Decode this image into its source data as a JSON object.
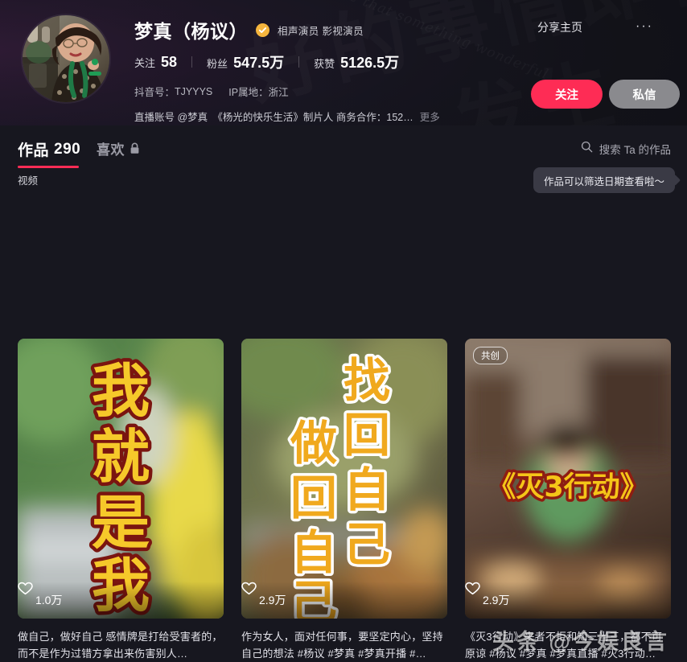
{
  "profile": {
    "name": "梦真（杨议）",
    "verified_icon": "verified-check-icon",
    "verified_tags": "相声演员 影视演员",
    "stats": [
      {
        "label": "关注",
        "value": "58"
      },
      {
        "label": "粉丝",
        "value": "547.5万"
      },
      {
        "label": "获赞",
        "value": "5126.5万"
      }
    ],
    "douyin_id_label": "抖音号：",
    "douyin_id_value": "TJYYYS",
    "ip_label": "IP属地：",
    "ip_value": "浙江",
    "bio": "直播账号 @梦真　《杨光的快乐生活》制片人 商务合作：152…",
    "bio_more": "更多",
    "share_label": "分享主页",
    "more_dots": "···",
    "follow_label": "关注",
    "message_label": "私信",
    "background_zh": "好的事情即将",
    "background_zh2": "发生",
    "background_en": "Always believe that something wonderful"
  },
  "tabs": {
    "works_label": "作品",
    "works_count": "290",
    "likes_label": "喜欢",
    "likes_lock_icon": "lock-icon",
    "search_icon": "search-icon",
    "search_placeholder": "搜索 Ta 的作品"
  },
  "filters": {
    "video_label": "视频",
    "tooltip": "作品可以筛选日期查看啦～"
  },
  "videos": [
    {
      "overlay_text": "我就是我",
      "overlay_style": "vertical-gold-red",
      "badge": "",
      "like_icon": "heart-icon",
      "likes": "1.0万",
      "caption": "做自己，做好自己 感情牌是打给受害者的，而不是作为过错方拿出来伤害别人…"
    },
    {
      "overlay_text": "找回自己",
      "overlay_text2": "做回自己",
      "overlay_style": "vertical-gold-white",
      "badge": "",
      "like_icon": "heart-icon",
      "likes": "2.9万",
      "caption": "作为女人，面对任何事，要坚定内心，坚持自己的想法 #杨议 #梦真 #梦真开播 #…"
    },
    {
      "overlay_text": "《灭3行动》",
      "overlay_style": "horizontal-gold-red",
      "badge": "共创",
      "like_icon": "heart-icon",
      "likes": "2.9万",
      "caption": "《灭3行动》来者不拒和知三当三，都不可原谅 #杨议 #梦真 #梦真直播 #灭3行动…"
    }
  ],
  "watermark": "头条 @今娱良言",
  "colors": {
    "accent": "#fe2c55",
    "verified": "#f5b53d",
    "page_bg": "#17171f",
    "message_btn": "#8a8a8e"
  }
}
